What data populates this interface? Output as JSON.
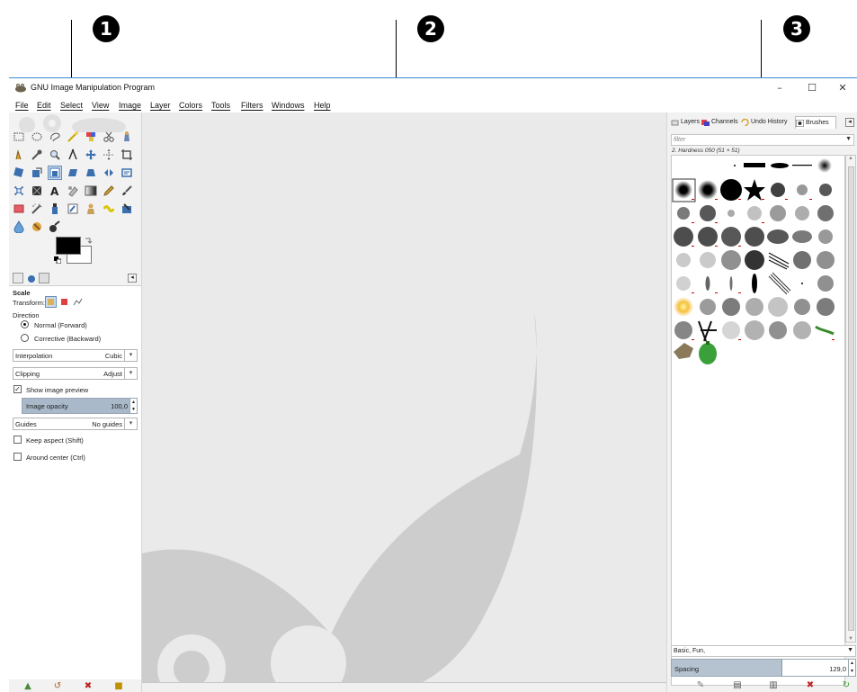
{
  "callouts": [
    "1",
    "2",
    "3"
  ],
  "window": {
    "title": "GNU Image Manipulation Program",
    "controls": {
      "minimize": "–",
      "maximize": "☐",
      "close": "✕"
    }
  },
  "menubar": [
    "File",
    "Edit",
    "Select",
    "View",
    "Image",
    "Layer",
    "Colors",
    "Tools",
    "Filters",
    "Windows",
    "Help"
  ],
  "toolbox": {
    "tools": [
      "rect-select",
      "ellipse-select",
      "free-select",
      "fuzzy-select",
      "by-color-select",
      "scissors-select",
      "foreground-select",
      "paths",
      "color-picker",
      "zoom",
      "measure",
      "move",
      "alignment",
      "crop",
      "rotate",
      "scale",
      "shear",
      "perspective",
      "flip",
      "cage-transform",
      "warp-transform",
      "unified-transform",
      "handle-transform",
      "text",
      "heal",
      "gradient",
      "pencil",
      "paintbrush",
      "eraser",
      "airbrush",
      "ink",
      "mypaint-brush",
      "clone",
      "perspective-clone",
      "smudge",
      "blur-sharpen",
      "dodge-burn",
      "bucket-fill"
    ],
    "active_tool": "scale",
    "fg_color": "#000000",
    "bg_color": "#ffffff"
  },
  "tool_options": {
    "title": "Scale",
    "transform_label": "Transform:",
    "direction_label": "Direction",
    "direction_options": [
      "Normal (Forward)",
      "Corrective (Backward)"
    ],
    "interpolation": {
      "label": "Interpolation",
      "value": "Cubic"
    },
    "clipping": {
      "label": "Clipping",
      "value": "Adjust"
    },
    "show_preview": {
      "label": "Show image preview",
      "checked": true
    },
    "image_opacity": {
      "label": "Image opacity",
      "value": "100,0",
      "fraction": 1.0
    },
    "guides": {
      "label": "Guides",
      "value": "No guides"
    },
    "keep_aspect": {
      "label": "Keep aspect (Shift)",
      "checked": false
    },
    "around_center": {
      "label": "Around center (Ctrl)",
      "checked": false
    }
  },
  "right_dock": {
    "tabs": [
      "Layers",
      "Channels",
      "Undo History",
      "Brushes"
    ],
    "active_tab": "Brushes",
    "filter_placeholder": "filter",
    "brush_name": "2. Hardness 050 (51 × 51)",
    "tag_value": "Basic, Fun,",
    "spacing": {
      "label": "Spacing",
      "value": "129,0",
      "fraction": 0.6
    }
  },
  "colors": {
    "window_border": "#3b8ad6",
    "selection": "#c9dbee",
    "slider_fill": "#a9b9c9",
    "wilber_watermark": "#c8c8c8"
  }
}
